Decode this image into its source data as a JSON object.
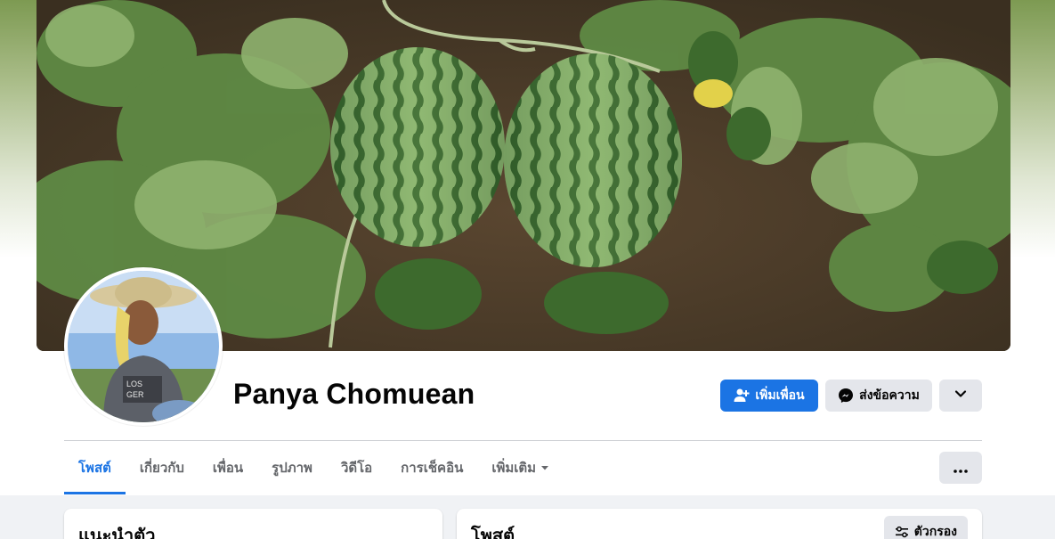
{
  "profile": {
    "name": "Panya Chomuean",
    "cover_alt": "watermelon-field-cover",
    "avatar_alt": "profile-photo"
  },
  "actions": {
    "add_friend": "เพิ่มเพื่อน",
    "message": "ส่งข้อความ"
  },
  "tabs": [
    {
      "label": "โพสต์",
      "active": true
    },
    {
      "label": "เกี่ยวกับ",
      "active": false
    },
    {
      "label": "เพื่อน",
      "active": false
    },
    {
      "label": "รูปภาพ",
      "active": false
    },
    {
      "label": "วิดีโอ",
      "active": false
    },
    {
      "label": "การเช็คอิน",
      "active": false
    },
    {
      "label": "เพิ่มเติม",
      "active": false
    }
  ],
  "sections": {
    "intro_title": "แนะนำตัว",
    "posts_title": "โพสต์",
    "filter_label": "ตัวกรอง"
  },
  "colors": {
    "accent": "#1b74e4",
    "button_gray": "#e4e6eb",
    "text_secondary": "#65676b"
  },
  "icons": {
    "add_friend": "person-add-icon",
    "message": "messenger-icon",
    "more": "chevron-down-icon",
    "tab_more": "caret-down-icon",
    "dots": "more-horizontal-icon",
    "filter": "sliders-icon"
  }
}
